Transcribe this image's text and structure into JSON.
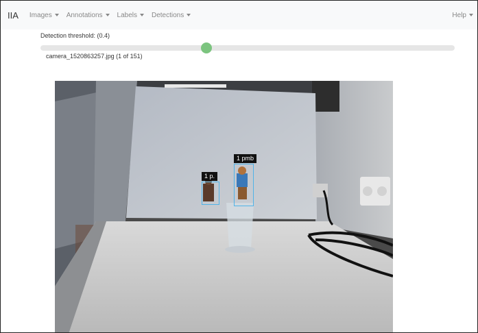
{
  "navbar": {
    "brand": "IIA",
    "menus": [
      {
        "label": "Images"
      },
      {
        "label": "Annotations"
      },
      {
        "label": "Labels"
      },
      {
        "label": "Detections"
      }
    ],
    "help": {
      "label": "Help"
    }
  },
  "threshold": {
    "label": "Detection threshold: (0.4)",
    "value": 0.4
  },
  "image": {
    "filename_label": "camera_1520863257.jpg (1 of 151)"
  },
  "detections": [
    {
      "label": "1 p."
    },
    {
      "label": "1 pmb"
    }
  ],
  "colors": {
    "slider_thumb": "#7cc47f",
    "detection_box": "#4fb3e8"
  }
}
